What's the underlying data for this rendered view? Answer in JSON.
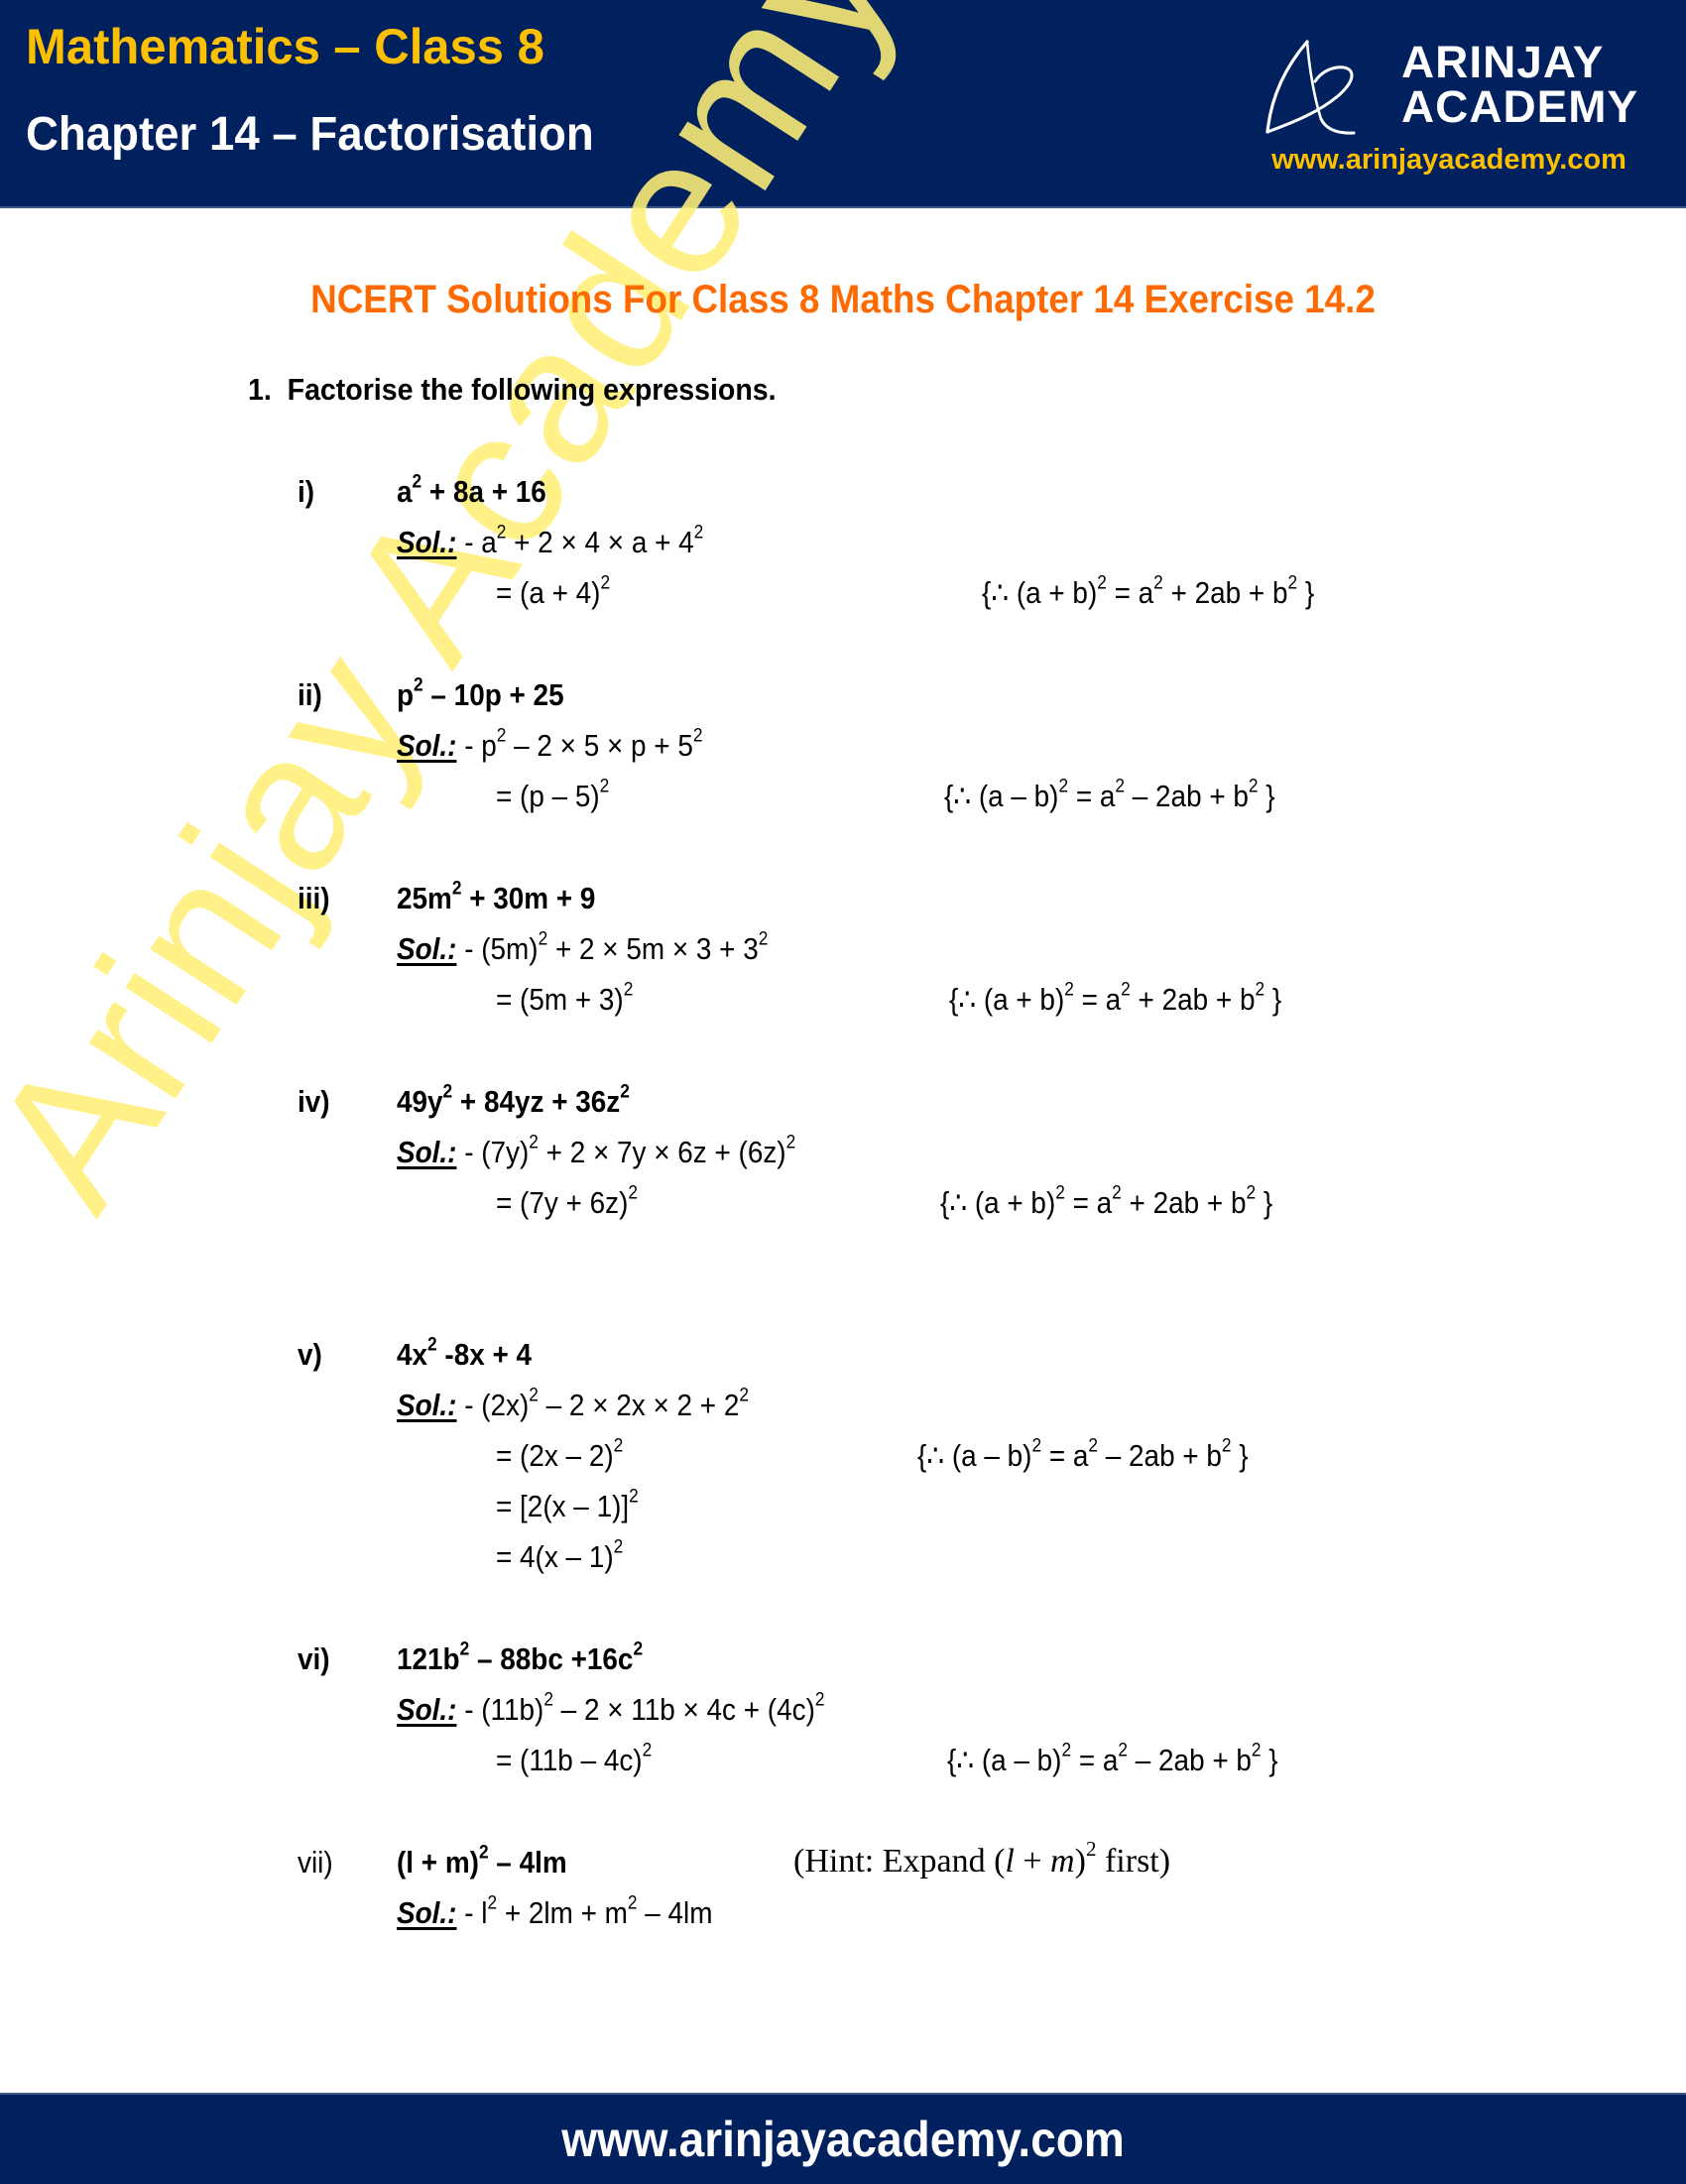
{
  "header": {
    "subject": "Mathematics – Class 8",
    "chapter": "Chapter 14 – Factorisation",
    "logo_line1": "ARINJAY",
    "logo_line2": "ACADEMY",
    "logo_icon": "arinjay-academy-logo-icon",
    "website": "www.arinjayacademy.com"
  },
  "watermark": "Arinjay Academy",
  "heading": "NCERT Solutions For Class 8 Maths Chapter 14 Exercise 14.2",
  "question": {
    "number": "1.",
    "text": "Factorise the following expressions."
  },
  "parts": [
    {
      "label": "i)",
      "expression_html": "a<sup>2</sup> + 8a + 16",
      "sol_label": "Sol.:",
      "sol_first_html": " - a<sup>2</sup> + 2 × 4 × a + 4<sup>2</sup>",
      "steps_html": [
        "= (a + 4)<sup>2</sup>"
      ],
      "reason_html": "{∴ (a + b)<sup>2</sup> = a<sup>2</sup> + 2ab + b<sup>2</sup> }"
    },
    {
      "label": "ii)",
      "expression_html": "p<sup>2</sup> – 10p + 25",
      "sol_label": "Sol.:",
      "sol_first_html": " - p<sup>2</sup> – 2 × 5 × p + 5<sup>2</sup>",
      "steps_html": [
        "= (p – 5)<sup>2</sup>"
      ],
      "reason_html": "{∴ (a – b)<sup>2</sup> = a<sup>2</sup> – 2ab + b<sup>2</sup> }"
    },
    {
      "label": "iii)",
      "expression_html": "25m<sup>2</sup> + 30m + 9",
      "sol_label": "Sol.:",
      "sol_first_html": " - (5m)<sup>2</sup> + 2 × 5m × 3 + 3<sup>2</sup>",
      "steps_html": [
        "= (5m + 3)<sup>2</sup>"
      ],
      "reason_html": "{∴ (a + b)<sup>2</sup> = a<sup>2</sup> + 2ab + b<sup>2</sup> }"
    },
    {
      "label": "iv)",
      "expression_html": "49y<sup>2</sup> + 84yz + 36z<sup>2</sup>",
      "sol_label": "Sol.:",
      "sol_first_html": " - (7y)<sup>2</sup> + 2 × 7y × 6z + (6z)<sup>2</sup>",
      "steps_html": [
        "= (7y + 6z)<sup>2</sup>"
      ],
      "reason_html": "{∴ (a + b)<sup>2</sup> = a<sup>2</sup> + 2ab + b<sup>2</sup> }"
    },
    {
      "label": "v)",
      "expression_html": "4x<sup>2</sup> -8x + 4",
      "sol_label": "Sol.:",
      "sol_first_html": " - (2x)<sup>2</sup> – 2 × 2x × 2 + 2<sup>2</sup>",
      "steps_html": [
        "= (2x – 2)<sup>2</sup>",
        "= [2(x – 1)]<sup>2</sup>",
        "= 4(x – 1)<sup>2</sup>"
      ],
      "reason_html": "{∴ (a – b)<sup>2</sup> = a<sup>2</sup> – 2ab + b<sup>2</sup> }"
    },
    {
      "label": "vi)",
      "expression_html": "121b<sup>2</sup> – 88bc +16c<sup>2</sup>",
      "sol_label": "Sol.:",
      "sol_first_html": " - (11b)<sup>2</sup> – 2 × 11b × 4c + (4c)<sup>2</sup>",
      "steps_html": [
        "= (11b – 4c)<sup>2</sup>"
      ],
      "reason_html": "{∴ (a – b)<sup>2</sup> = a<sup>2</sup> – 2ab + b<sup>2</sup> }"
    },
    {
      "label": "vii)",
      "expression_html": "(l + m)<sup>2</sup> – 4lm",
      "hint_html": "(Hint: Expand (<i>l</i> + <i>m</i>)<sup>2</sup> first)",
      "sol_label": "Sol.:",
      "sol_first_html": " - l<sup>2</sup> + 2lm + m<sup>2</sup> – 4lm",
      "steps_html": [],
      "reason_html": ""
    }
  ],
  "footer": {
    "website": "www.arinjayacademy.com"
  },
  "colors": {
    "navy": "#00205e",
    "gold": "#fcc000",
    "orange": "#ff6a00",
    "watermark_yellow": "#fff077"
  }
}
